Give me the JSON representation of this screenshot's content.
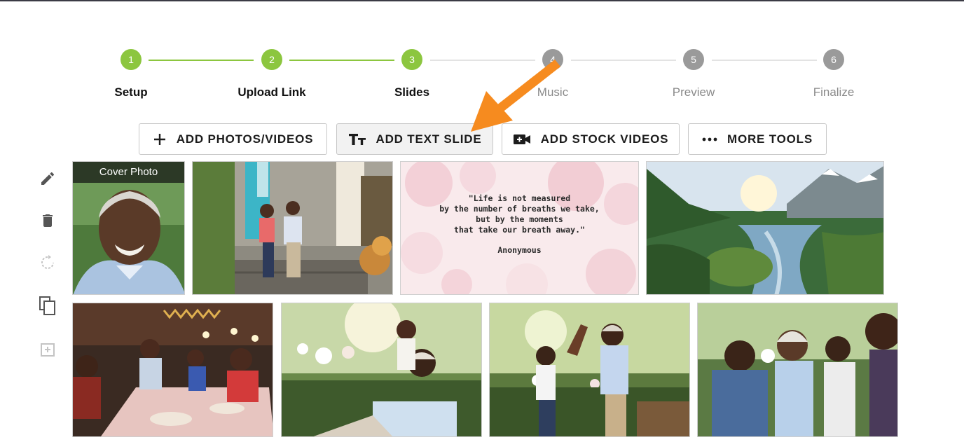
{
  "stepper": {
    "steps": [
      {
        "number": "1",
        "label": "Setup",
        "state": "done"
      },
      {
        "number": "2",
        "label": "Upload Link",
        "state": "done"
      },
      {
        "number": "3",
        "label": "Slides",
        "state": "current"
      },
      {
        "number": "4",
        "label": "Music",
        "state": "todo"
      },
      {
        "number": "5",
        "label": "Preview",
        "state": "todo"
      },
      {
        "number": "6",
        "label": "Finalize",
        "state": "todo"
      }
    ],
    "colors": {
      "done": "#8cc63f",
      "todo": "#9a9a9a"
    }
  },
  "toolbar": {
    "add_photos_videos": {
      "label": "ADD PHOTOS/VIDEOS",
      "icon": "plus-icon"
    },
    "add_text_slide": {
      "label": "ADD TEXT SLIDE",
      "icon": "text-size-icon"
    },
    "add_stock_videos": {
      "label": "ADD STOCK VIDEOS",
      "icon": "video-camera-add-icon"
    },
    "more_tools": {
      "label": "MORE TOOLS",
      "icon": "more-dots-icon"
    }
  },
  "side_tools": [
    "edit-pencil-icon",
    "trash-icon",
    "rotate-icon",
    "duplicate-icon",
    "add-slide-icon"
  ],
  "slides": {
    "cover_label": "Cover Photo",
    "quote": {
      "text": "\"Life is not measured\nby the number of breaths we take,\nbut by the moments\nthat take our breath away.\"",
      "author": "Anonymous"
    }
  },
  "annotation": {
    "arrow_color": "#f68b1f",
    "points_to": "add-text-slide-button"
  }
}
